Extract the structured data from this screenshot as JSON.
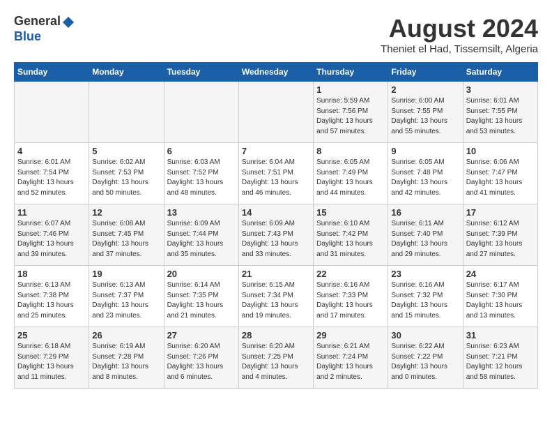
{
  "header": {
    "logo_general": "General",
    "logo_blue": "Blue",
    "month_title": "August 2024",
    "location": "Theniet el Had, Tissemsilt, Algeria"
  },
  "days_of_week": [
    "Sunday",
    "Monday",
    "Tuesday",
    "Wednesday",
    "Thursday",
    "Friday",
    "Saturday"
  ],
  "weeks": [
    [
      {
        "day": "",
        "info": ""
      },
      {
        "day": "",
        "info": ""
      },
      {
        "day": "",
        "info": ""
      },
      {
        "day": "",
        "info": ""
      },
      {
        "day": "1",
        "info": "Sunrise: 5:59 AM\nSunset: 7:56 PM\nDaylight: 13 hours\nand 57 minutes."
      },
      {
        "day": "2",
        "info": "Sunrise: 6:00 AM\nSunset: 7:55 PM\nDaylight: 13 hours\nand 55 minutes."
      },
      {
        "day": "3",
        "info": "Sunrise: 6:01 AM\nSunset: 7:55 PM\nDaylight: 13 hours\nand 53 minutes."
      }
    ],
    [
      {
        "day": "4",
        "info": "Sunrise: 6:01 AM\nSunset: 7:54 PM\nDaylight: 13 hours\nand 52 minutes."
      },
      {
        "day": "5",
        "info": "Sunrise: 6:02 AM\nSunset: 7:53 PM\nDaylight: 13 hours\nand 50 minutes."
      },
      {
        "day": "6",
        "info": "Sunrise: 6:03 AM\nSunset: 7:52 PM\nDaylight: 13 hours\nand 48 minutes."
      },
      {
        "day": "7",
        "info": "Sunrise: 6:04 AM\nSunset: 7:51 PM\nDaylight: 13 hours\nand 46 minutes."
      },
      {
        "day": "8",
        "info": "Sunrise: 6:05 AM\nSunset: 7:49 PM\nDaylight: 13 hours\nand 44 minutes."
      },
      {
        "day": "9",
        "info": "Sunrise: 6:05 AM\nSunset: 7:48 PM\nDaylight: 13 hours\nand 42 minutes."
      },
      {
        "day": "10",
        "info": "Sunrise: 6:06 AM\nSunset: 7:47 PM\nDaylight: 13 hours\nand 41 minutes."
      }
    ],
    [
      {
        "day": "11",
        "info": "Sunrise: 6:07 AM\nSunset: 7:46 PM\nDaylight: 13 hours\nand 39 minutes."
      },
      {
        "day": "12",
        "info": "Sunrise: 6:08 AM\nSunset: 7:45 PM\nDaylight: 13 hours\nand 37 minutes."
      },
      {
        "day": "13",
        "info": "Sunrise: 6:09 AM\nSunset: 7:44 PM\nDaylight: 13 hours\nand 35 minutes."
      },
      {
        "day": "14",
        "info": "Sunrise: 6:09 AM\nSunset: 7:43 PM\nDaylight: 13 hours\nand 33 minutes."
      },
      {
        "day": "15",
        "info": "Sunrise: 6:10 AM\nSunset: 7:42 PM\nDaylight: 13 hours\nand 31 minutes."
      },
      {
        "day": "16",
        "info": "Sunrise: 6:11 AM\nSunset: 7:40 PM\nDaylight: 13 hours\nand 29 minutes."
      },
      {
        "day": "17",
        "info": "Sunrise: 6:12 AM\nSunset: 7:39 PM\nDaylight: 13 hours\nand 27 minutes."
      }
    ],
    [
      {
        "day": "18",
        "info": "Sunrise: 6:13 AM\nSunset: 7:38 PM\nDaylight: 13 hours\nand 25 minutes."
      },
      {
        "day": "19",
        "info": "Sunrise: 6:13 AM\nSunset: 7:37 PM\nDaylight: 13 hours\nand 23 minutes."
      },
      {
        "day": "20",
        "info": "Sunrise: 6:14 AM\nSunset: 7:35 PM\nDaylight: 13 hours\nand 21 minutes."
      },
      {
        "day": "21",
        "info": "Sunrise: 6:15 AM\nSunset: 7:34 PM\nDaylight: 13 hours\nand 19 minutes."
      },
      {
        "day": "22",
        "info": "Sunrise: 6:16 AM\nSunset: 7:33 PM\nDaylight: 13 hours\nand 17 minutes."
      },
      {
        "day": "23",
        "info": "Sunrise: 6:16 AM\nSunset: 7:32 PM\nDaylight: 13 hours\nand 15 minutes."
      },
      {
        "day": "24",
        "info": "Sunrise: 6:17 AM\nSunset: 7:30 PM\nDaylight: 13 hours\nand 13 minutes."
      }
    ],
    [
      {
        "day": "25",
        "info": "Sunrise: 6:18 AM\nSunset: 7:29 PM\nDaylight: 13 hours\nand 11 minutes."
      },
      {
        "day": "26",
        "info": "Sunrise: 6:19 AM\nSunset: 7:28 PM\nDaylight: 13 hours\nand 8 minutes."
      },
      {
        "day": "27",
        "info": "Sunrise: 6:20 AM\nSunset: 7:26 PM\nDaylight: 13 hours\nand 6 minutes."
      },
      {
        "day": "28",
        "info": "Sunrise: 6:20 AM\nSunset: 7:25 PM\nDaylight: 13 hours\nand 4 minutes."
      },
      {
        "day": "29",
        "info": "Sunrise: 6:21 AM\nSunset: 7:24 PM\nDaylight: 13 hours\nand 2 minutes."
      },
      {
        "day": "30",
        "info": "Sunrise: 6:22 AM\nSunset: 7:22 PM\nDaylight: 13 hours\nand 0 minutes."
      },
      {
        "day": "31",
        "info": "Sunrise: 6:23 AM\nSunset: 7:21 PM\nDaylight: 12 hours\nand 58 minutes."
      }
    ]
  ]
}
